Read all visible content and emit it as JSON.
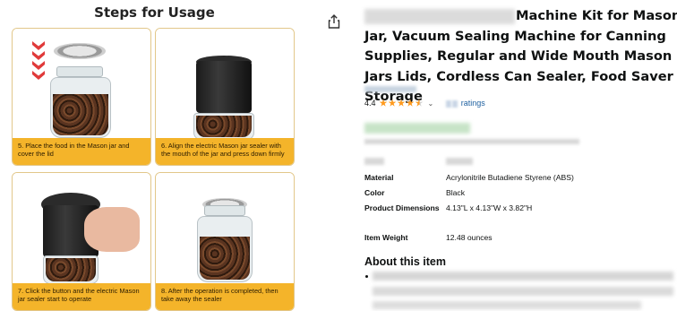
{
  "steps_image": {
    "title": "Steps for Usage",
    "steps": [
      {
        "caption": "5. Place the food in the Mason jar and cover the lid"
      },
      {
        "caption": "6. Align the electric Mason jar sealer with the mouth of the jar and press down firmly"
      },
      {
        "caption": "7. Click the button and the electric Mason jar sealer start to operate"
      },
      {
        "caption": "8. After the operation is completed, then take away the sealer"
      }
    ]
  },
  "product": {
    "title_line1": "Machine Kit for Mason",
    "title_rest": "Jar, Vacuum Sealing Machine for Canning Supplies, Regular and Wide Mouth Mason Jars Lids, Cordless Can Sealer, Food Saver Storage",
    "rating": "4.4",
    "rating_stars": 4.5,
    "rating_count_label": "ratings"
  },
  "specs": [
    {
      "label": "Material",
      "value": "Acrylonitrile Butadiene Styrene (ABS)"
    },
    {
      "label": "Color",
      "value": "Black"
    },
    {
      "label": "Product Dimensions",
      "value": "4.13\"L x 4.13\"W x 3.82\"H"
    },
    {
      "label": "Item Weight",
      "value": "12.48 ounces"
    }
  ],
  "about": {
    "heading": "About this item"
  },
  "colors": {
    "caption_bg": "#f4b42a",
    "star": "#ff9a1e",
    "link": "#2162a1",
    "card_border": "#e2c78a"
  }
}
